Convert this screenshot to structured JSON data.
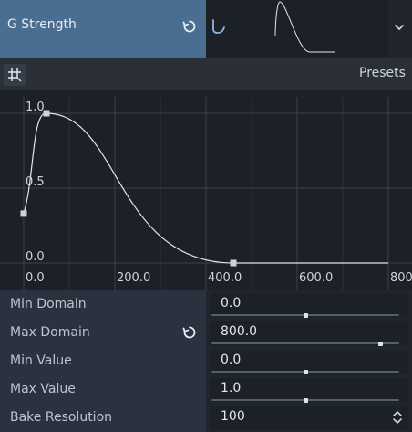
{
  "header": {
    "property_label": "G Strength",
    "revert_icon": "revert-icon",
    "dropdown_icon": "chevron-down-icon",
    "curve_type_icon": "curve-icon"
  },
  "toolbar": {
    "grid_snap_icon": "grid-snap-icon",
    "presets_label": "Presets"
  },
  "chart_data": {
    "type": "line",
    "x_ticks": [
      "0.0",
      "200.0",
      "400.0",
      "600.0",
      "800"
    ],
    "y_ticks": [
      "1.0",
      "0.5",
      "0.0"
    ],
    "xlim": [
      0,
      800
    ],
    "ylim": [
      0,
      1
    ],
    "grid": true,
    "points": [
      {
        "x": 0,
        "y": 0.33
      },
      {
        "x": 50,
        "y": 1.0
      },
      {
        "x": 460,
        "y": 0.0
      }
    ]
  },
  "properties": [
    {
      "label": "Min Domain",
      "value": "0.0",
      "slider": 0.5,
      "revert": false,
      "spin": false
    },
    {
      "label": "Max Domain",
      "value": "800.0",
      "slider": 0.9,
      "revert": true,
      "spin": false
    },
    {
      "label": "Min Value",
      "value": "0.0",
      "slider": 0.5,
      "revert": false,
      "spin": false
    },
    {
      "label": "Max Value",
      "value": "1.0",
      "slider": 0.5,
      "revert": false,
      "spin": false
    },
    {
      "label": "Bake Resolution",
      "value": "100",
      "slider": null,
      "revert": false,
      "spin": true
    }
  ],
  "colors": {
    "accent_header": "#4a6d92",
    "curve": "#e6e6e6",
    "handle": "#cfd3d8",
    "grid": "#3a414c"
  }
}
